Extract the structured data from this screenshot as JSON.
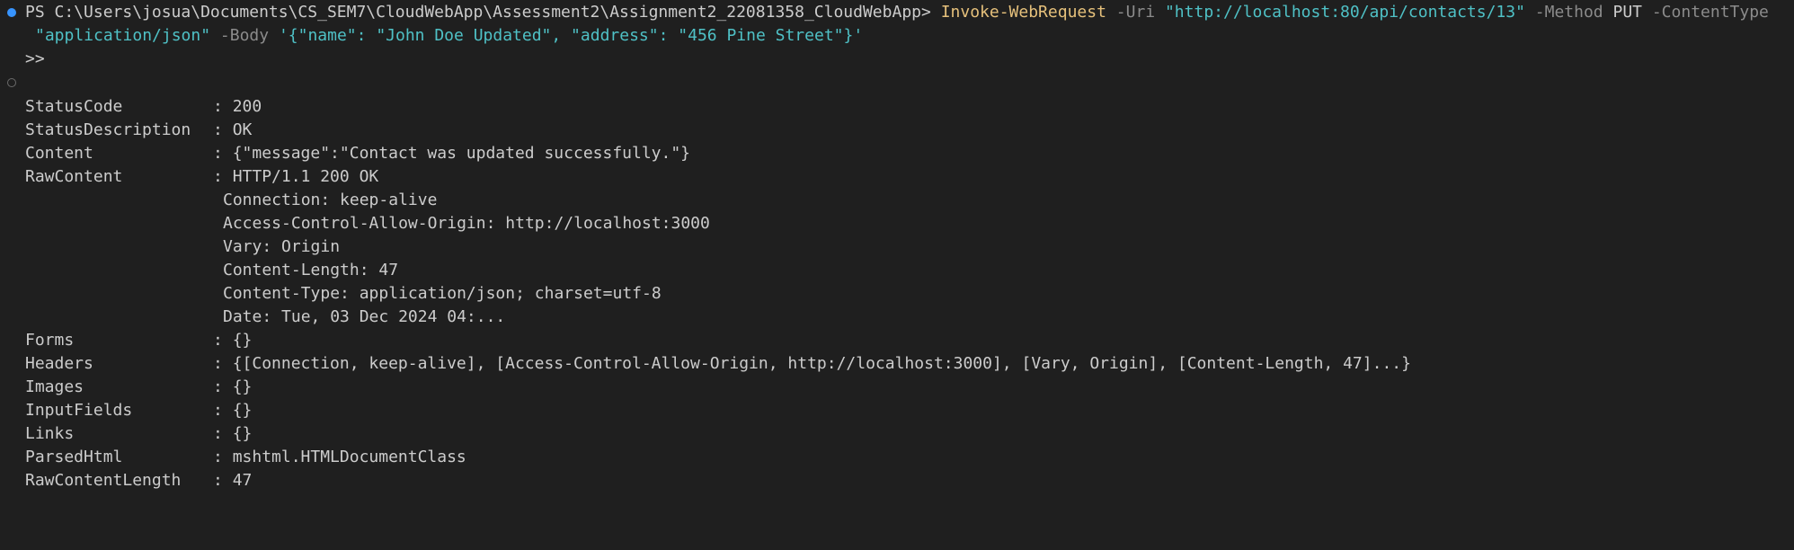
{
  "prompt": {
    "path": "PS C:\\Users\\josua\\Documents\\CS_SEM7\\CloudWebApp\\Assessment2\\Assignment2_22081358_CloudWebApp>",
    "command": "Invoke-WebRequest",
    "uri_flag": "-Uri",
    "uri_value": "\"http://localhost:80/api/contacts/13\"",
    "method_flag": "-Method",
    "method_value": "PUT",
    "content_type_flag": "-ContentType",
    "content_type_value": "\"application/json\"",
    "body_flag": "-Body",
    "body_value": "'{\"name\": \"John Doe Updated\", \"address\": \"456 Pine Street\"}'",
    "continuation": ">>"
  },
  "output": {
    "separator": ":",
    "fields": [
      {
        "key": "StatusCode",
        "value": "200"
      },
      {
        "key": "StatusDescription",
        "value": "OK"
      },
      {
        "key": "Content",
        "value": "{\"message\":\"Contact was updated successfully.\"}"
      },
      {
        "key": "RawContent",
        "value": "HTTP/1.1 200 OK"
      }
    ],
    "raw_content_lines": [
      "Connection: keep-alive",
      "Access-Control-Allow-Origin: http://localhost:3000",
      "Vary: Origin",
      "Content-Length: 47",
      "Content-Type: application/json; charset=utf-8",
      "Date: Tue, 03 Dec 2024 04:..."
    ],
    "more_fields": [
      {
        "key": "Forms",
        "value": "{}"
      },
      {
        "key": "Headers",
        "value": "{[Connection, keep-alive], [Access-Control-Allow-Origin, http://localhost:3000], [Vary, Origin], [Content-Length, 47]...}"
      },
      {
        "key": "Images",
        "value": "{}"
      },
      {
        "key": "InputFields",
        "value": "{}"
      },
      {
        "key": "Links",
        "value": "{}"
      },
      {
        "key": "ParsedHtml",
        "value": "mshtml.HTMLDocumentClass"
      },
      {
        "key": "RawContentLength",
        "value": "47"
      }
    ]
  },
  "colors": {
    "background": "#1f1f1f",
    "text": "#cccccc",
    "command": "#e5c07b",
    "parameter": "#8b8b8b",
    "string": "#4fc1c6",
    "status_dot": "#3794ff"
  }
}
